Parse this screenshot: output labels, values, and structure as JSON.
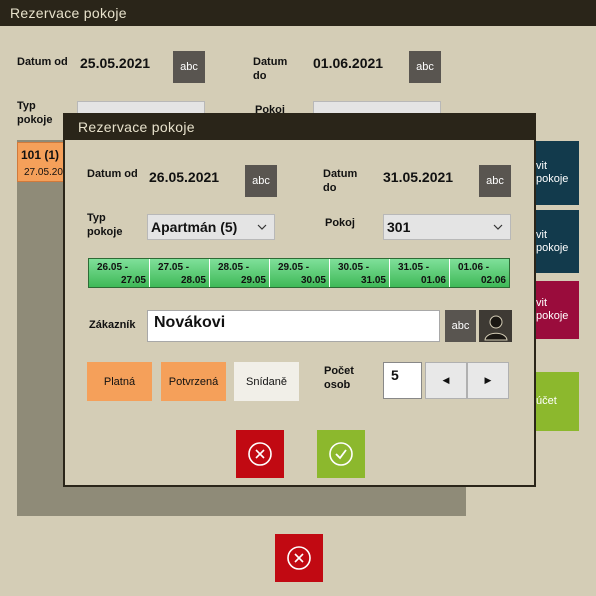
{
  "back": {
    "title": "Rezervace pokoje",
    "date_from_label": "Datum od",
    "date_from_value": "25.05.2021",
    "date_to_label": "Datum do",
    "date_to_value": "01.06.2021",
    "abc_label": "abc",
    "room_type_label": "Typ pokoje",
    "room_label": "Pokoj",
    "room_item_title": "101 (1)",
    "room_item_date": "27.05.20",
    "side_buttons": [
      "vit pokoje",
      "vit pokoje",
      "vit pokoje",
      "účet"
    ]
  },
  "dialog": {
    "title": "Rezervace pokoje",
    "date_from_label": "Datum od",
    "date_from_value": "26.05.2021",
    "date_to_label": "Datum do",
    "date_to_value": "31.05.2021",
    "abc_label": "abc",
    "room_type_label": "Typ pokoje",
    "room_type_value": "Apartmán (5)",
    "room_label": "Pokoj",
    "room_value": "301",
    "date_ranges": [
      {
        "a": "26.05 -",
        "b": "27.05"
      },
      {
        "a": "27.05 -",
        "b": "28.05"
      },
      {
        "a": "28.05 -",
        "b": "29.05"
      },
      {
        "a": "29.05 -",
        "b": "30.05"
      },
      {
        "a": "30.05 -",
        "b": "31.05"
      },
      {
        "a": "31.05 -",
        "b": "01.06"
      },
      {
        "a": "01.06 -",
        "b": "02.06"
      }
    ],
    "customer_label": "Zákazník",
    "customer_value": "Novákovi",
    "status_buttons": [
      "Platná",
      "Potvrzená",
      "Snídaně"
    ],
    "persons_label": "Počet osob",
    "persons_value": "5"
  },
  "colors": {
    "accent_orange": "#f5a05a",
    "green": "#8cb82d",
    "red": "#c10912",
    "teal": "#123a4c",
    "crimson": "#9a0c3c"
  }
}
